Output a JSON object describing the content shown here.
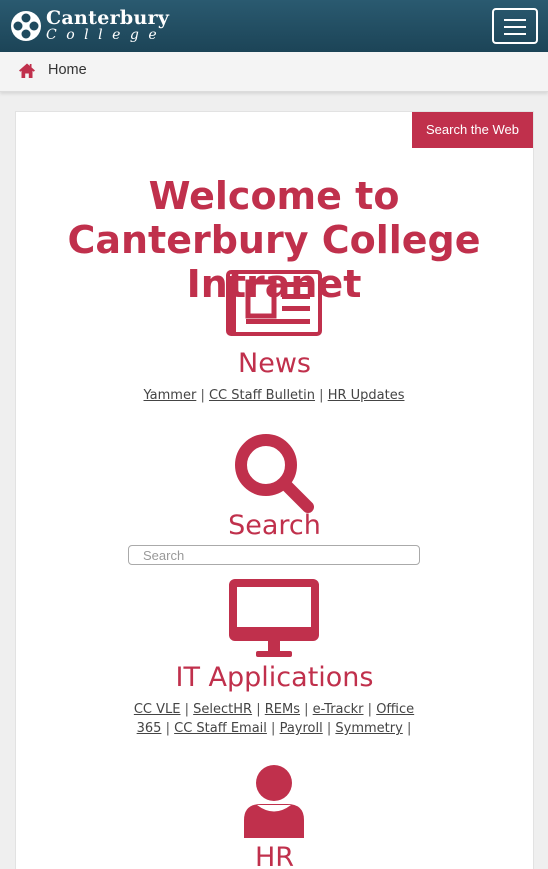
{
  "header": {
    "logo_line1": "Canterbury",
    "logo_line2": "College",
    "brand_color": "#1f4a5e"
  },
  "breadcrumb": {
    "home_label": "Home",
    "icon": "home-icon"
  },
  "search_web_button": "Search the Web",
  "page_title": "Welcome to Canterbury College Intranet",
  "accent_color": "#c0304c",
  "sections": {
    "news": {
      "title": "News",
      "icon": "newspaper-icon",
      "links": [
        "Yammer",
        "CC Staff Bulletin",
        "HR Updates"
      ]
    },
    "search": {
      "title": "Search",
      "icon": "magnifier-icon",
      "placeholder": "Search",
      "value": ""
    },
    "it": {
      "title": "IT Applications",
      "icon": "monitor-icon",
      "links": [
        "CC VLE",
        "SelectHR",
        "REMs",
        "e-Trackr",
        "Office 365",
        "CC Staff Email",
        "Payroll",
        "Symmetry"
      ]
    },
    "hr": {
      "title": "HR",
      "icon": "person-icon"
    }
  }
}
